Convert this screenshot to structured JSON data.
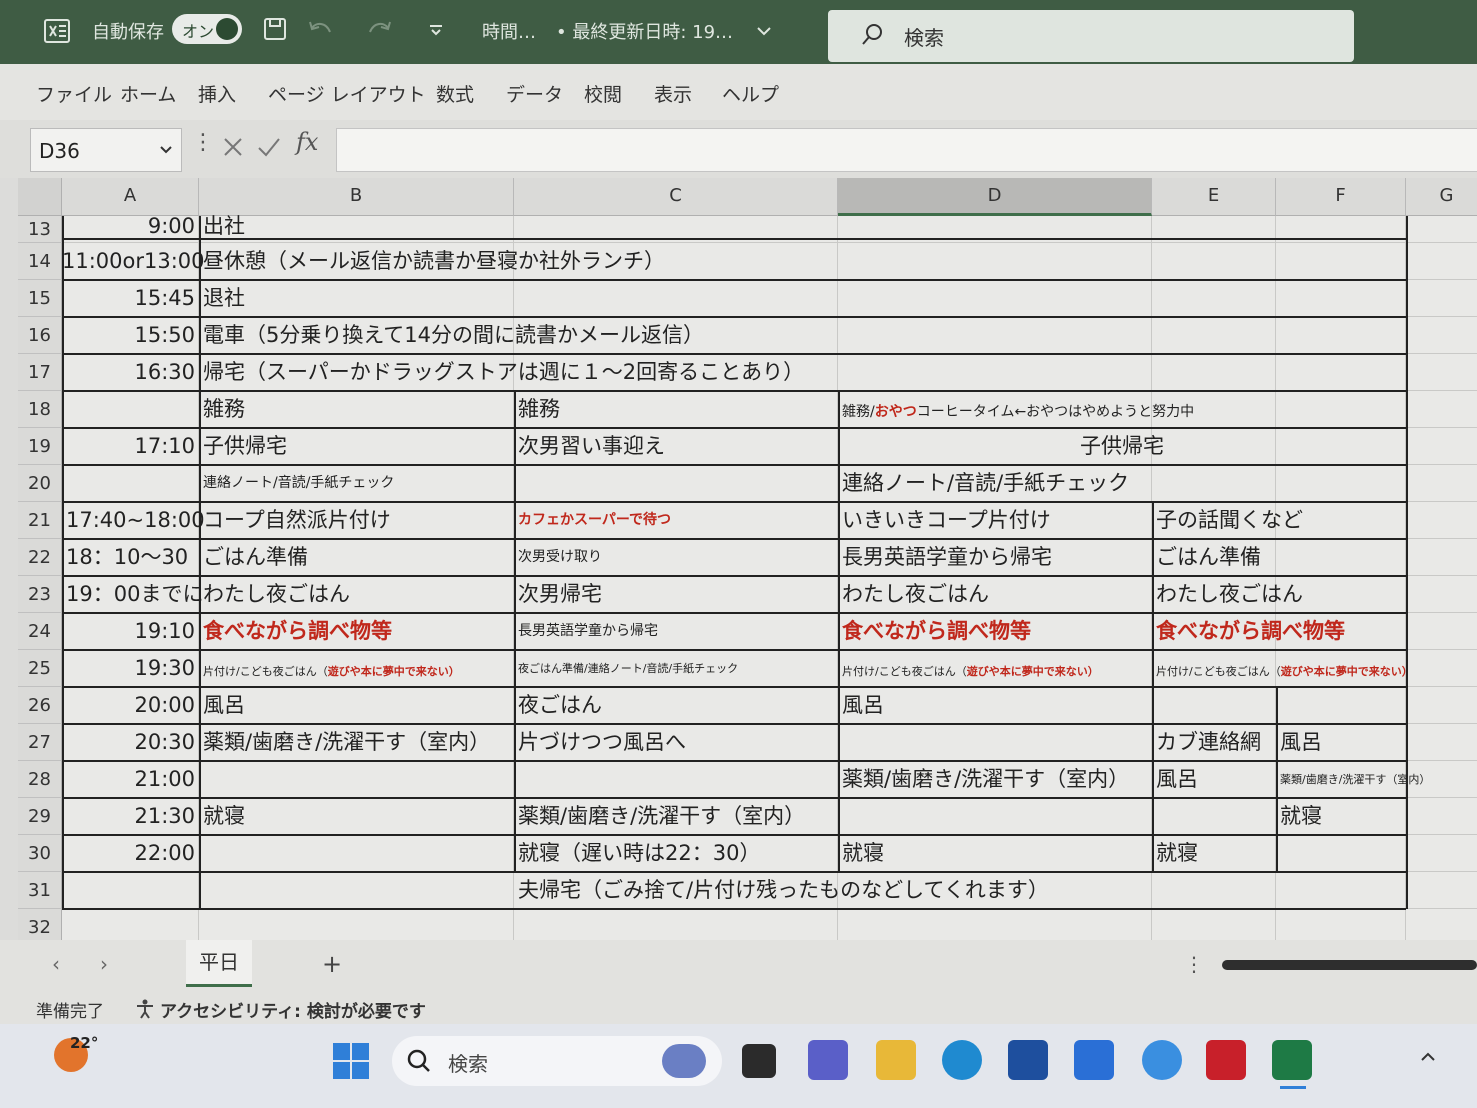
{
  "titlebar": {
    "autosave_label": "自動保存",
    "autosave_state": "オン",
    "doc_title": "時間…",
    "last_modified": "• 最終更新日時: 19…",
    "search_placeholder": "検索"
  },
  "menu": [
    "ファイル",
    "ホーム",
    "挿入",
    "ページ レイアウト",
    "数式",
    "データ",
    "校閲",
    "表示",
    "ヘルプ"
  ],
  "formula_bar": {
    "name_box": "D36",
    "formula": ""
  },
  "columns": [
    "A",
    "B",
    "C",
    "D",
    "E",
    "F",
    "G"
  ],
  "rows": [
    "13",
    "14",
    "15",
    "16",
    "17",
    "18",
    "19",
    "20",
    "21",
    "22",
    "23",
    "24",
    "25",
    "26",
    "27",
    "28",
    "29",
    "30",
    "31",
    "32"
  ],
  "cells": {
    "A13": "9:00",
    "B13": "出社",
    "A14": "11:00or13:00",
    "B14": "昼休憩（メール返信か読書か昼寝か社外ランチ）",
    "A15": "15:45",
    "B15": "退社",
    "A16": "15:50",
    "B16": "電車（5分乗り換えて14分の間に読書かメール返信）",
    "A17": "16:30",
    "B17": "帰宅（スーパーかドラッグストアは週に１～2回寄ることあり）",
    "B18": "雑務",
    "C18": "雑務",
    "D18_a": "雑務/",
    "D18_b": "おやつ",
    "D18_c": "コーヒータイム←おやつはやめようと努力中",
    "A19": "17:10",
    "B19": "子供帰宅",
    "C19": "次男習い事迎え",
    "D19": "子供帰宅",
    "B20": "連絡ノート/音読/手紙チェック",
    "D20": "連絡ノート/音読/手紙チェック",
    "A21": "17:40~18:00",
    "B21": "コープ自然派片付け",
    "C21": "カフェかスーパーで待つ",
    "D21": "いきいきコープ片付け",
    "E21": "子の話聞くなど",
    "A22": "18：10～30",
    "B22": "ごはん準備",
    "C22": "次男受け取り",
    "D22": "長男英語学童から帰宅",
    "E22": "ごはん準備",
    "A23": "19：00までに",
    "B23": "わたし夜ごはん",
    "C23": "次男帰宅",
    "D23": "わたし夜ごはん",
    "E23": "わたし夜ごはん",
    "A24": "19:10",
    "B24": "食べながら調べ物等",
    "C24": "長男英語学童から帰宅",
    "D24": "食べながら調べ物等",
    "E24": "食べながら調べ物等",
    "A25": "19:30",
    "B25_a": "片付け/こども夜ごはん（",
    "B25_b": "遊びや本に夢中で来ない）",
    "C25": "夜ごはん準備/連絡ノート/音読/手紙チェック",
    "D25_a": "片付け/こども夜ごはん（",
    "D25_b": "遊びや本に夢中で来ない）",
    "E25_a": "片付け/こども夜ごはん（",
    "E25_b": "遊びや本に夢中で来ない）",
    "A26": "20:00",
    "B26": "風呂",
    "C26": "夜ごはん",
    "D26": "風呂",
    "A27": "20:30",
    "B27": "薬類/歯磨き/洗濯干す（室内）",
    "C27": "片づけつつ風呂へ",
    "E27": "カブ連絡網",
    "F27": "風呂",
    "A28": "21:00",
    "D28": "薬類/歯磨き/洗濯干す（室内）",
    "E28": "風呂",
    "F28": "薬類/歯磨き/洗濯干す（室内）",
    "A29": "21:30",
    "B29": "就寝",
    "C29": "薬類/歯磨き/洗濯干す（室内）",
    "F29": "就寝",
    "A30": "22:00",
    "C30": "就寝（遅い時は22：30）",
    "D30": "就寝",
    "E30": "就寝",
    "B31": "夫帰宅（ごみ捨て/片付け残ったものなどしてくれます）"
  },
  "sheet_tabs": {
    "active": "平日",
    "add": "+"
  },
  "status": {
    "ready": "準備完了",
    "accessibility": "アクセシビリティ: 検討が必要です"
  },
  "taskbar": {
    "weather_temp": "22°",
    "search_placeholder": "検索"
  },
  "colors": {
    "accent": "#3f6e4a",
    "title_bg": "#3f5c44",
    "emphasis_red": "#c0281c"
  }
}
